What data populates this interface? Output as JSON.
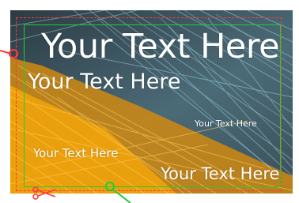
{
  "text_layers": {
    "headline": "Your Text Here",
    "subhead": "Your Text Here",
    "small_right": "Your Text Here",
    "bottom_left": "Your Text Here",
    "bottom_right": "Your Text Here"
  },
  "colors": {
    "text": "#ffffff",
    "fibers_orange": "#f0a30a",
    "fibers_cyan": "#9fd6e6",
    "cut_line": "#ff3b3b",
    "safe_area": "#22cc33"
  },
  "icons": {
    "rotate_handle": "rotate-handle-icon",
    "scissors": "scissors-icon"
  }
}
